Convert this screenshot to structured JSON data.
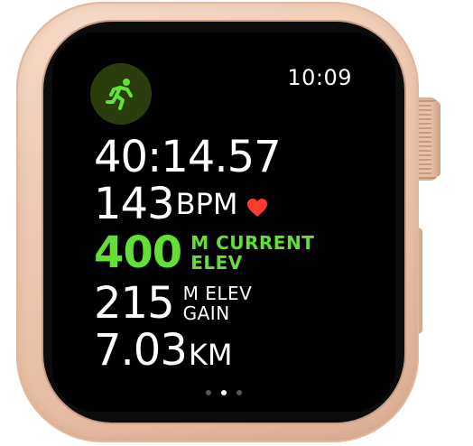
{
  "status_bar": {
    "time": "10:09"
  },
  "workout": {
    "icon": "running-figure-icon",
    "icon_color": "#62e035",
    "icon_bg": "#2b3d0d"
  },
  "metrics": {
    "elapsed_time": "40:14.57",
    "heart_rate": {
      "value": "143",
      "unit": "BPM",
      "icon": "heart-icon",
      "icon_color": "#ff3b30"
    },
    "current_elevation": {
      "value": "400",
      "label_line1": "M CURRENT",
      "label_line2": "ELEV",
      "color": "#62e035"
    },
    "elevation_gain": {
      "value": "215",
      "label_line1": "M ELEV",
      "label_line2": "GAIN"
    },
    "distance": {
      "value": "7.03",
      "unit": "KM"
    }
  },
  "page_indicator": {
    "total": 3,
    "active_index": 1
  },
  "device": {
    "case_color": "#efc9b1"
  }
}
